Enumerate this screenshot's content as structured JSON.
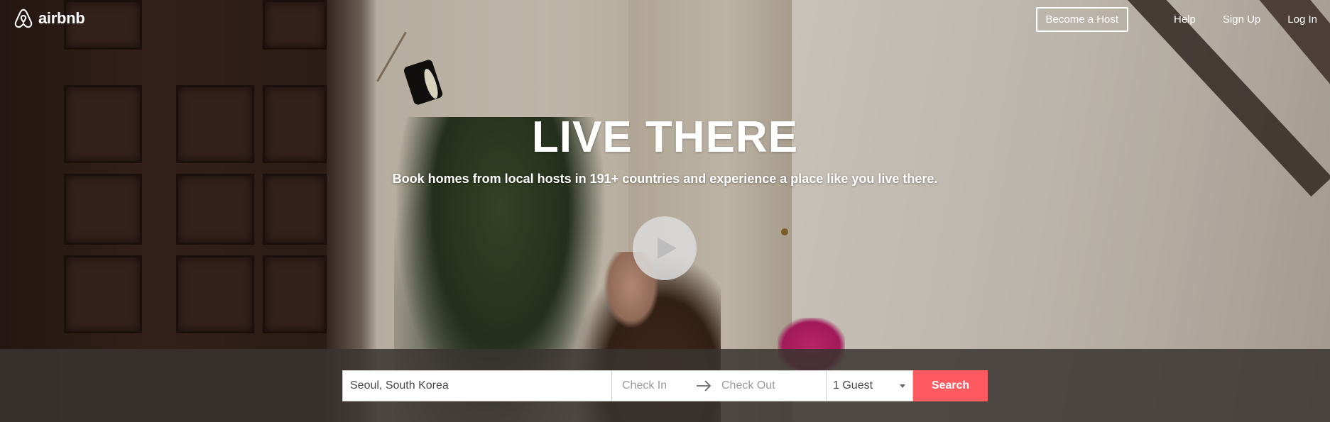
{
  "brand": {
    "name": "airbnb",
    "accent": "#ff5a5f"
  },
  "nav": {
    "become_host": "Become a Host",
    "help": "Help",
    "sign_up": "Sign Up",
    "log_in": "Log In"
  },
  "hero": {
    "headline": "LIVE THERE",
    "subhead": "Book homes from local hosts in 191+ countries and experience a place like you live there.",
    "play_icon": "play-icon"
  },
  "search": {
    "location_value": "Seoul, South Korea",
    "check_in_placeholder": "Check In",
    "check_out_placeholder": "Check Out",
    "guests_value": "1 Guest",
    "search_label": "Search"
  }
}
